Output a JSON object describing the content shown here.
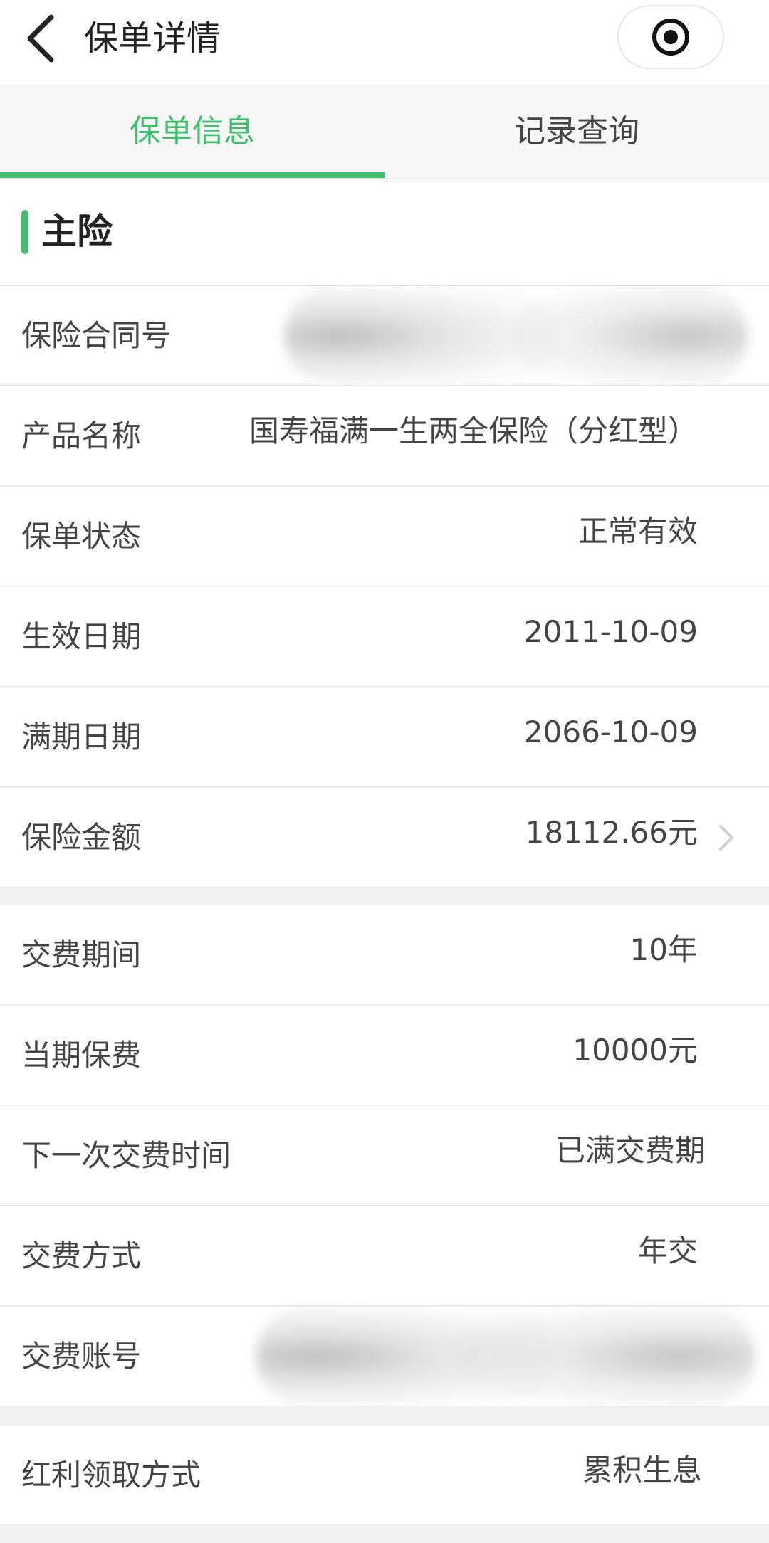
{
  "header": {
    "title": "保单详情",
    "back_icon": "chevron-left-icon",
    "menu_icon": "target-record-icon"
  },
  "tabs": [
    {
      "label": "保单信息",
      "active": true
    },
    {
      "label": "记录查询",
      "active": false
    }
  ],
  "colors": {
    "accent": "#3fbf6b",
    "text": "#444444",
    "background": "#f2f2f2"
  },
  "section": {
    "title": "主险"
  },
  "main_rows": [
    {
      "label": "保险合同号",
      "value": ""
    },
    {
      "label": "产品名称",
      "value": "国寿福满一生两全保险（分红型）"
    },
    {
      "label": "保单状态",
      "value": "正常有效"
    },
    {
      "label": "生效日期",
      "value": "2011-10-09"
    },
    {
      "label": "满期日期",
      "value": "2066-10-09"
    },
    {
      "label": "保险金额",
      "value": "18112.66元"
    }
  ],
  "payment_rows": [
    {
      "label": "交费期间",
      "value": "10年"
    },
    {
      "label": "当期保费",
      "value": "10000元"
    },
    {
      "label": "下一次交费时间",
      "value": "已满交费期"
    },
    {
      "label": "交费方式",
      "value": "年交"
    },
    {
      "label": "交费账号",
      "value": ""
    }
  ],
  "dividend_rows": [
    {
      "label": "红利领取方式",
      "value": "累积生息"
    }
  ]
}
